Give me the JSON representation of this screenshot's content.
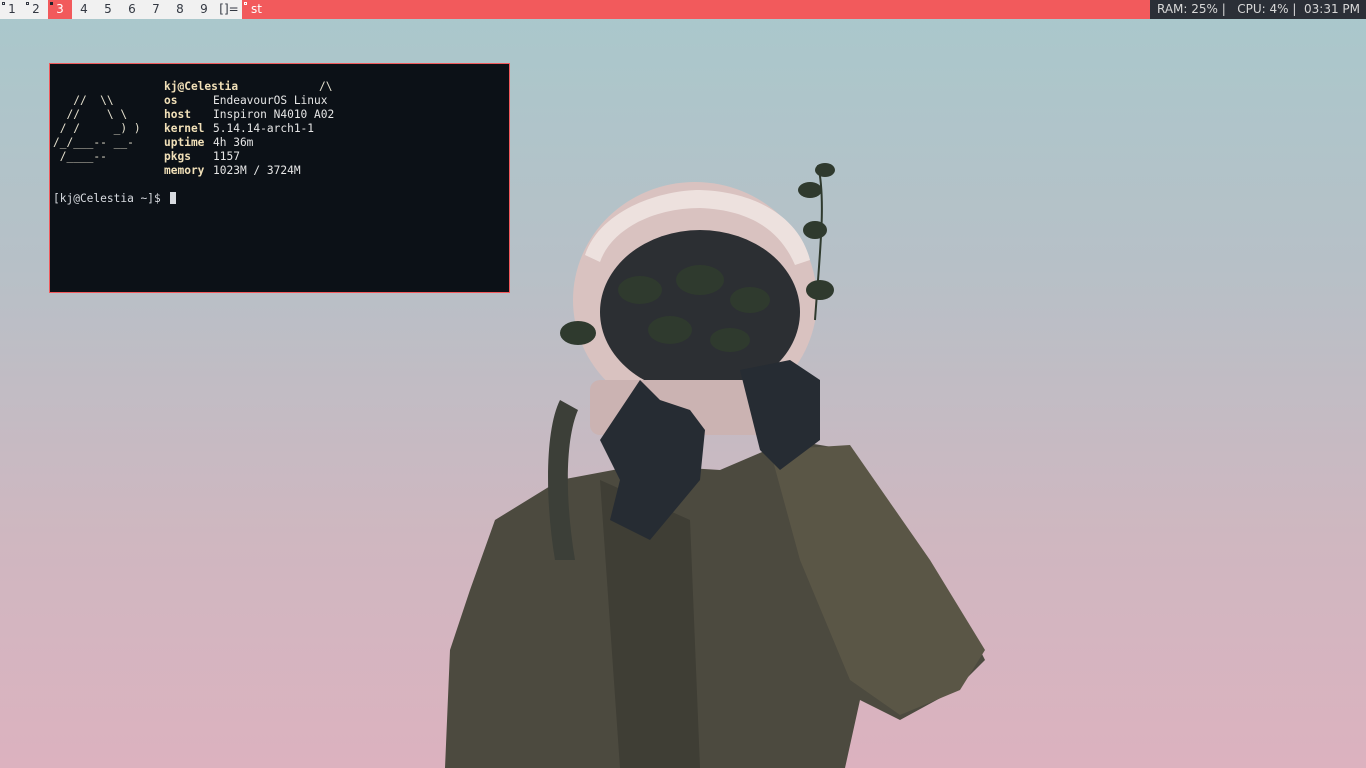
{
  "bar": {
    "workspaces": [
      {
        "label": "1",
        "occupied": true
      },
      {
        "label": "2",
        "occupied": true
      },
      {
        "label": "3",
        "occupied": true,
        "active": true
      },
      {
        "label": "4"
      },
      {
        "label": "5"
      },
      {
        "label": "6"
      },
      {
        "label": "7"
      },
      {
        "label": "8"
      },
      {
        "label": "9"
      }
    ],
    "layout_symbol": "[]=",
    "window_title": "st",
    "status_text": "RAM: 25% |   CPU: 4% |  03:31 PM",
    "accent_color": "#f25a5c"
  },
  "terminal": {
    "logo_lines": [
      "",
      "   //  \\\\",
      "  //    \\ \\",
      " / /     _) )",
      "/_/___-- __-",
      " /____--"
    ],
    "user_host": "kj@Celestia",
    "arch_glyph": "/\\",
    "info": [
      {
        "key": "os",
        "value": "EndeavourOS Linux"
      },
      {
        "key": "host",
        "value": "Inspiron N4010 A02"
      },
      {
        "key": "kernel",
        "value": "5.14.14-arch1-1"
      },
      {
        "key": "uptime",
        "value": "4h 36m"
      },
      {
        "key": "pkgs",
        "value": "1157"
      },
      {
        "key": "memory",
        "value": "1023M / 3724M"
      }
    ],
    "prompt": "[kj@Celestia ~]$ "
  }
}
